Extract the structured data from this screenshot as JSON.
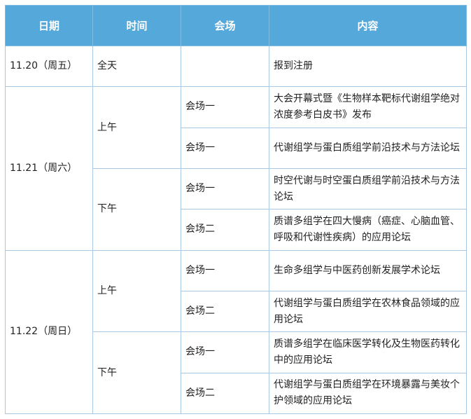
{
  "header": {
    "date": "日期",
    "time": "时间",
    "venue": "会场",
    "content": "内容"
  },
  "days": [
    {
      "date": "11.20（周五）",
      "slot": "全天",
      "venue": "",
      "content": "报到注册"
    },
    {
      "date": "11.21（周六）",
      "am": {
        "label": "上午",
        "sessions": [
          {
            "venue": "会场一",
            "content": "大会开幕式暨《生物样本靶标代谢组学绝对浓度参考白皮书》发布"
          },
          {
            "venue": "会场一",
            "content": "代谢组学与蛋白质组学前沿技术与方法论坛"
          }
        ]
      },
      "pm": {
        "label": "下午",
        "sessions": [
          {
            "venue": "会场一",
            "content": "时空代谢与时空蛋白质组学前沿技术与方法论坛"
          },
          {
            "venue": "会场二",
            "content": "质谱多组学在四大慢病（癌症、心脑血管、呼吸和代谢性疾病）的应用论坛"
          }
        ]
      }
    },
    {
      "date": "11.22（周日）",
      "am": {
        "label": "上午",
        "sessions": [
          {
            "venue": "会场一",
            "content": "生命多组学与中医药创新发展学术论坛"
          },
          {
            "venue": "会场二",
            "content": "代谢组学与蛋白质组学在农林食品领域的应用论坛"
          }
        ]
      },
      "pm": {
        "label": "下午",
        "sessions": [
          {
            "venue": "会场一",
            "content": "质谱多组学在临床医学转化及生物医药转化中的应用论坛"
          },
          {
            "venue": "会场二",
            "content": "代谢组学与蛋白质组学在环境暴露与美妆个护领域的应用论坛"
          }
        ]
      }
    }
  ]
}
